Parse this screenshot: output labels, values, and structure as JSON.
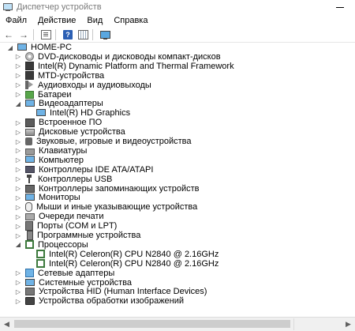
{
  "window": {
    "title": "Диспетчер устройств"
  },
  "menu": [
    {
      "label": "Файл"
    },
    {
      "label": "Действие"
    },
    {
      "label": "Вид"
    },
    {
      "label": "Справка"
    }
  ],
  "toolbar": {
    "back": "back-arrow",
    "forward": "forward-arrow",
    "help_glyph": "?"
  },
  "tree": {
    "root": {
      "label": "HOME-PC",
      "icon": "computer-icon",
      "expanded": true
    },
    "categories": [
      {
        "label": "DVD-дисководы и дисководы компакт-дисков",
        "icon": "disc-drive-icon",
        "expanded": false,
        "children": []
      },
      {
        "label": "Intel(R) Dynamic Platform and Thermal Framework",
        "icon": "chip-icon",
        "expanded": false,
        "children": []
      },
      {
        "label": "MTD-устройства",
        "icon": "chip-icon",
        "expanded": false,
        "children": []
      },
      {
        "label": "Аудиовходы и аудиовыходы",
        "icon": "speaker-icon",
        "expanded": false,
        "children": []
      },
      {
        "label": "Батареи",
        "icon": "battery-icon",
        "expanded": false,
        "children": []
      },
      {
        "label": "Видеоадаптеры",
        "icon": "monitor-icon",
        "expanded": true,
        "children": [
          {
            "label": "Intel(R) HD Graphics",
            "icon": "monitor-icon"
          }
        ]
      },
      {
        "label": "Встроенное ПО",
        "icon": "firmware-icon",
        "expanded": false,
        "children": []
      },
      {
        "label": "Дисковые устройства",
        "icon": "hdd-icon",
        "expanded": false,
        "children": []
      },
      {
        "label": "Звуковые, игровые и видеоустройства",
        "icon": "sound-icon",
        "expanded": false,
        "children": []
      },
      {
        "label": "Клавиатуры",
        "icon": "keyboard-icon",
        "expanded": false,
        "children": []
      },
      {
        "label": "Компьютер",
        "icon": "computer-icon",
        "expanded": false,
        "children": []
      },
      {
        "label": "Контроллеры IDE ATA/ATAPI",
        "icon": "ide-icon",
        "expanded": false,
        "children": []
      },
      {
        "label": "Контроллеры USB",
        "icon": "usb-icon",
        "expanded": false,
        "children": []
      },
      {
        "label": "Контроллеры запоминающих устройств",
        "icon": "storage-icon",
        "expanded": false,
        "children": []
      },
      {
        "label": "Мониторы",
        "icon": "monitor-icon",
        "expanded": false,
        "children": []
      },
      {
        "label": "Мыши и иные указывающие устройства",
        "icon": "mouse-icon",
        "expanded": false,
        "children": []
      },
      {
        "label": "Очереди печати",
        "icon": "printer-icon",
        "expanded": false,
        "children": []
      },
      {
        "label": "Порты (COM и LPT)",
        "icon": "ports-icon",
        "expanded": false,
        "children": []
      },
      {
        "label": "Программные устройства",
        "icon": "software-icon",
        "expanded": false,
        "children": []
      },
      {
        "label": "Процессоры",
        "icon": "cpu-icon",
        "expanded": true,
        "children": [
          {
            "label": "Intel(R) Celeron(R) CPU  N2840  @ 2.16GHz",
            "icon": "cpu-icon"
          },
          {
            "label": "Intel(R) Celeron(R) CPU  N2840  @ 2.16GHz",
            "icon": "cpu-icon"
          }
        ]
      },
      {
        "label": "Сетевые адаптеры",
        "icon": "network-icon",
        "expanded": false,
        "children": []
      },
      {
        "label": "Системные устройства",
        "icon": "system-icon",
        "expanded": false,
        "children": []
      },
      {
        "label": "Устройства HID (Human Interface Devices)",
        "icon": "hid-icon",
        "expanded": false,
        "children": []
      },
      {
        "label": "Устройства обработки изображений",
        "icon": "imaging-icon",
        "expanded": false,
        "children": []
      }
    ]
  }
}
